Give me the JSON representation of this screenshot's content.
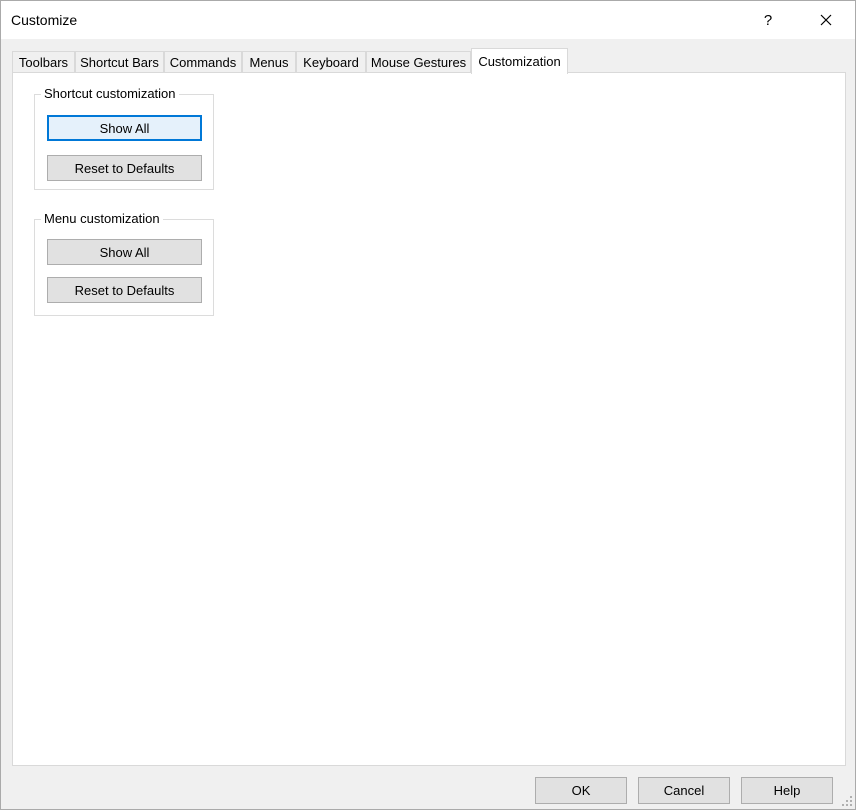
{
  "window": {
    "title": "Customize",
    "help_glyph": "?",
    "close_glyph": "✕"
  },
  "tabs": [
    {
      "label": "Toolbars",
      "active": false
    },
    {
      "label": "Shortcut Bars",
      "active": false
    },
    {
      "label": "Commands",
      "active": false
    },
    {
      "label": "Menus",
      "active": false
    },
    {
      "label": "Keyboard",
      "active": false
    },
    {
      "label": "Mouse Gestures",
      "active": false
    },
    {
      "label": "Customization",
      "active": true
    }
  ],
  "shortcut_group": {
    "label": "Shortcut customization",
    "show_all": "Show All",
    "reset": "Reset to Defaults"
  },
  "menu_group": {
    "label": "Menu customization",
    "show_all": "Show All",
    "reset": "Reset to Defaults"
  },
  "footer": {
    "ok": "OK",
    "cancel": "Cancel",
    "help": "Help"
  },
  "colors": {
    "focus_accent": "#0078d7",
    "button_face": "#e1e1e1",
    "dialog_bg": "#f0f0f0"
  }
}
